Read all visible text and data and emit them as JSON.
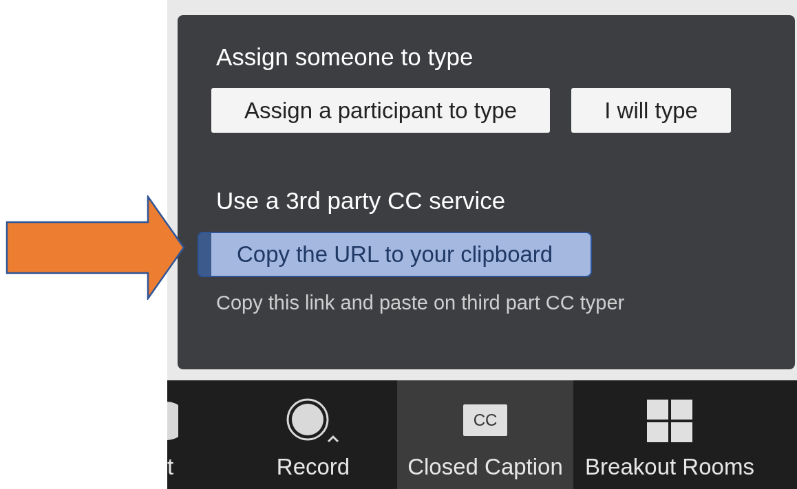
{
  "panel": {
    "sections": [
      {
        "heading": "Assign someone to type",
        "buttons": [
          {
            "label": "Assign a participant to type",
            "highlighted": false
          },
          {
            "label": "I will type",
            "highlighted": false
          }
        ]
      },
      {
        "heading": "Use a 3rd party CC service",
        "buttons": [
          {
            "label": "Copy the URL to your clipboard",
            "highlighted": true
          }
        ],
        "note": "Copy this link and paste on third part CC typer"
      }
    ]
  },
  "toolbar": {
    "items": [
      {
        "kind": "partial",
        "label": "t",
        "selected": false
      },
      {
        "kind": "record",
        "label": "Record",
        "selected": false
      },
      {
        "kind": "cc",
        "label": "Closed Caption",
        "icon_text": "CC",
        "selected": true
      },
      {
        "kind": "grid",
        "label": "Breakout Rooms",
        "selected": false
      }
    ]
  }
}
